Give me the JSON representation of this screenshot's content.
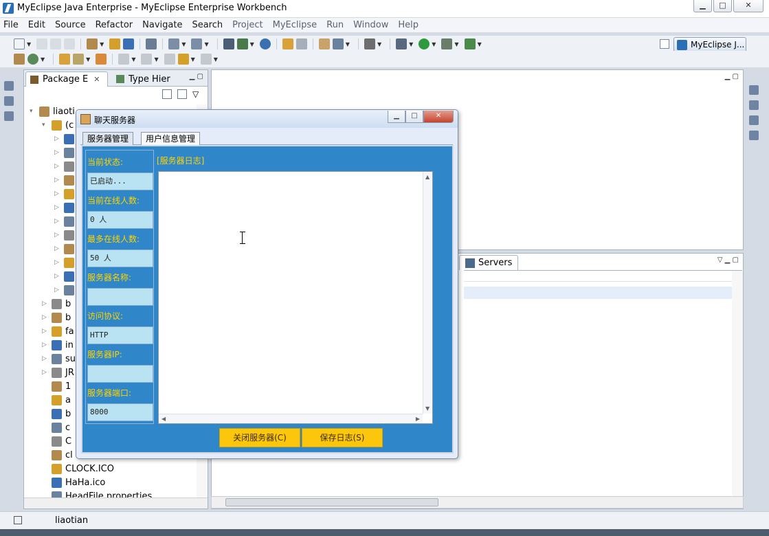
{
  "window": {
    "title": "MyEclipse Java Enterprise - MyEclipse Enterprise Workbench"
  },
  "menu": [
    "File",
    "Edit",
    "Source",
    "Refactor",
    "Navigate",
    "Search",
    "Project",
    "MyEclipse",
    "Run",
    "Window",
    "Help"
  ],
  "perspective": {
    "label": "MyEclipse J..."
  },
  "package_explorer": {
    "tab_label": "Package E",
    "tab2_label": "Type Hier",
    "tree": [
      {
        "label": "liaoti",
        "indent": 0
      },
      {
        "label": "(c",
        "indent": 1
      },
      {
        "label": "",
        "indent": 2
      },
      {
        "label": "",
        "indent": 2
      },
      {
        "label": "",
        "indent": 2
      },
      {
        "label": "",
        "indent": 2
      },
      {
        "label": "",
        "indent": 2
      },
      {
        "label": "",
        "indent": 2
      },
      {
        "label": "",
        "indent": 2
      },
      {
        "label": "",
        "indent": 2
      },
      {
        "label": "",
        "indent": 2
      },
      {
        "label": "",
        "indent": 2
      },
      {
        "label": "",
        "indent": 2
      },
      {
        "label": "",
        "indent": 2
      },
      {
        "label": "b",
        "indent": 1
      },
      {
        "label": "b",
        "indent": 1
      },
      {
        "label": "fa",
        "indent": 1
      },
      {
        "label": "in",
        "indent": 1
      },
      {
        "label": "su",
        "indent": 1
      },
      {
        "label": "JR",
        "indent": 1
      },
      {
        "label": "1",
        "indent": 1
      },
      {
        "label": "a",
        "indent": 1
      },
      {
        "label": "b",
        "indent": 1
      },
      {
        "label": "c",
        "indent": 1
      },
      {
        "label": "C",
        "indent": 1
      },
      {
        "label": "cl",
        "indent": 1
      },
      {
        "label": "CLOCK.ICO",
        "indent": 1
      },
      {
        "label": "HaHa.ico",
        "indent": 1
      },
      {
        "label": "HeadFile.properties",
        "indent": 1
      }
    ]
  },
  "servers_panel": {
    "tab_label": "Servers"
  },
  "status_bar": {
    "text": "liaotian"
  },
  "dialog": {
    "title": "聊天服务器",
    "tabs": [
      "服务器管理",
      "用户信息管理"
    ],
    "fields": [
      {
        "label": "当前状态:",
        "value": "已启动..."
      },
      {
        "label": "当前在线人数:",
        "value": "0 人"
      },
      {
        "label": "最多在线人数:",
        "value": "50 人"
      },
      {
        "label": "服务器名称:",
        "value": ""
      },
      {
        "label": "访问协议:",
        "value": "HTTP"
      },
      {
        "label": "服务器IP:",
        "value": ""
      },
      {
        "label": "服务器端口:",
        "value": "8000"
      }
    ],
    "log_label": "[服务器日志]",
    "buttons": {
      "stop": "关闭服务器(C)",
      "save_log": "保存日志(S)"
    }
  }
}
